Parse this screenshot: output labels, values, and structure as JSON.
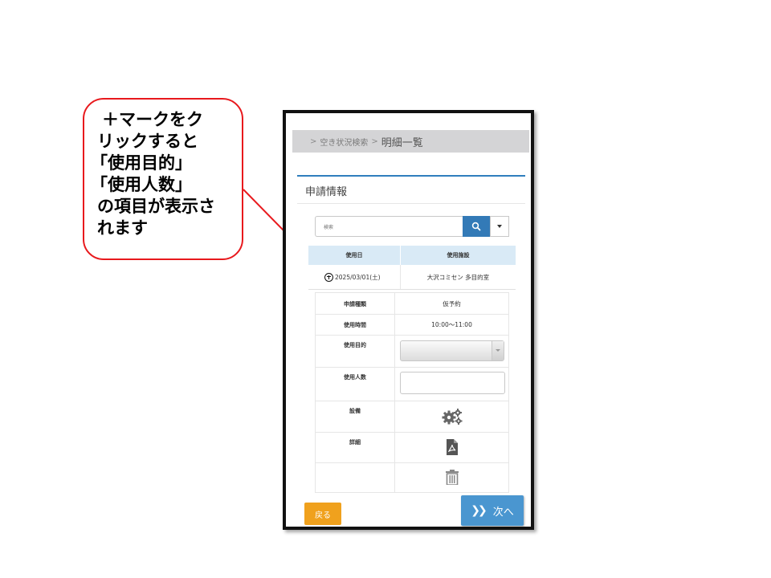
{
  "callout": {
    "lines": [
      "＋マークをク",
      "リックすると",
      "「使用目的」",
      "「使用人数」",
      "の項目が表示さ",
      "れます"
    ]
  },
  "breadcrumb": {
    "separator": ">",
    "link": "空き状況検索",
    "current": "明細一覧"
  },
  "panel": {
    "title": "申請情報"
  },
  "search": {
    "placeholder": "検索"
  },
  "list": {
    "headers": [
      "使用日",
      "使用施設"
    ],
    "rows": [
      {
        "date": "2025/03/01(土)",
        "facility": "大沢コミセン 多目的室"
      }
    ]
  },
  "detail": {
    "application_type_label": "申請種類",
    "application_type_value": "仮予約",
    "usage_time_label": "使用時間",
    "usage_time_value": "10:00〜11:00",
    "purpose_label": "使用目的",
    "purpose_value": "",
    "people_label": "使用人数",
    "people_value": "",
    "equipment_label": "設備",
    "details_label": "詳細"
  },
  "icons": {
    "search": "search-icon",
    "dropdown": "caret-down-icon",
    "expand": "plus-circle-icon",
    "equipment": "gears-icon",
    "details": "pdf-file-icon",
    "delete": "trash-icon",
    "next": "double-chevron-right-icon"
  },
  "buttons": {
    "back": "戻る",
    "next": "次へ"
  },
  "colors": {
    "callout_border": "#e8191d",
    "primary": "#337ab7",
    "back_button": "#f0a11d",
    "next_button": "#4a96d0",
    "table_header": "#d9eaf6"
  }
}
